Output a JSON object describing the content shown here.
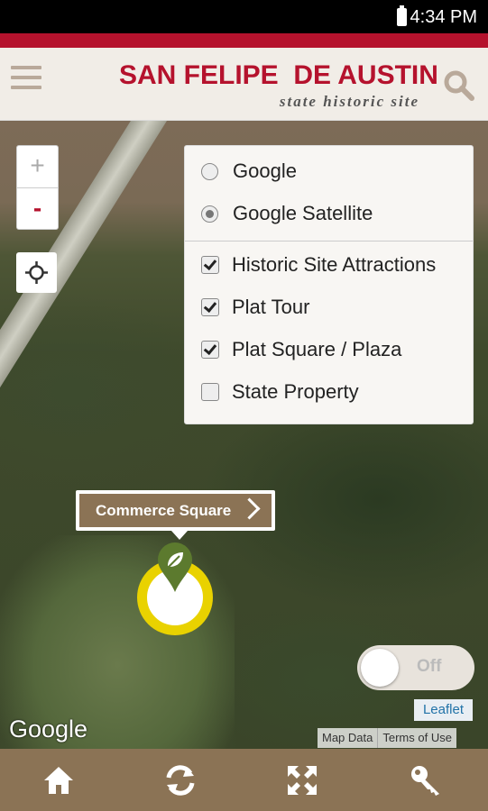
{
  "status_bar": {
    "time": "4:34 PM"
  },
  "header": {
    "title": "SAN FELIPE  DE AUSTIN",
    "subtitle": "state historic site",
    "menu_icon": "hamburger-menu-icon",
    "search_icon": "search-icon"
  },
  "map": {
    "zoom_in": "+",
    "zoom_out": "-",
    "locate_icon": "crosshair-locate-icon",
    "base_layers": [
      {
        "label": "Google",
        "selected": false
      },
      {
        "label": "Google Satellite",
        "selected": true
      }
    ],
    "overlays": [
      {
        "label": "Historic Site Attractions",
        "checked": true
      },
      {
        "label": "Plat Tour",
        "checked": true
      },
      {
        "label": "Plat Square / Plaza",
        "checked": true
      },
      {
        "label": "State Property",
        "checked": false
      }
    ],
    "callout": {
      "label": "Commerce Square"
    },
    "marker_icon": "leaf-pin-icon",
    "toggle": {
      "label": "Off",
      "on": false
    },
    "leaflet_link": "Leaflet",
    "google_logo": "Google",
    "attribution": [
      "Map Data",
      "Terms of Use"
    ]
  },
  "bottom_nav": {
    "items": [
      {
        "icon": "home-icon"
      },
      {
        "icon": "refresh-icon"
      },
      {
        "icon": "fullscreen-icon"
      },
      {
        "icon": "key-icon"
      }
    ]
  },
  "colors": {
    "brand_red": "#b5122d",
    "brown": "#8b7355",
    "marker_yellow": "#e9d200",
    "marker_green": "#5c7a2e"
  }
}
